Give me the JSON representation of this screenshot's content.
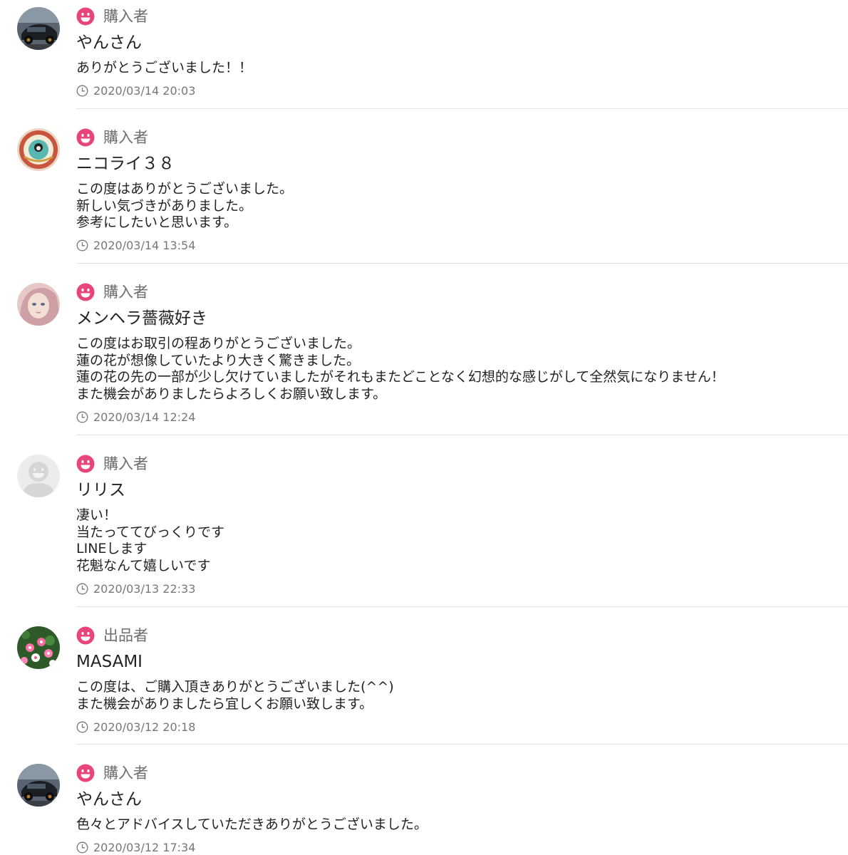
{
  "reviews": [
    {
      "role": "購入者",
      "username": "やんさん",
      "comment": [
        "ありがとうございました！！"
      ],
      "timestamp": "2020/03/14 20:03",
      "avatar": "car-photo"
    },
    {
      "role": "購入者",
      "username": "ニコライ３８",
      "comment": [
        "この度はありがとうございました。",
        "新しい気づきがありました。",
        "参考にしたいと思います。"
      ],
      "timestamp": "2020/03/14 13:54",
      "avatar": "bowl-photo"
    },
    {
      "role": "購入者",
      "username": "メンヘラ薔薇好き",
      "comment": [
        "この度はお取引の程ありがとうございました。",
        "蓮の花が想像していたより大きく驚きました。",
        "蓮の花の先の一部が少し欠けていましたがそれもまたどことなく幻想的な感じがして全然気になりません！",
        "また機会がありましたらよろしくお願い致します。"
      ],
      "timestamp": "2020/03/14 12:24",
      "avatar": "doll-photo"
    },
    {
      "role": "購入者",
      "username": "リリス",
      "comment": [
        "凄い！",
        "当たっててびっくりです",
        "LINEします",
        "花魁なんて嬉しいです"
      ],
      "timestamp": "2020/03/13 22:33",
      "avatar": "default-face"
    },
    {
      "role": "出品者",
      "username": "MASAMI",
      "comment": [
        "この度は、ご購入頂きありがとうございました(^^)",
        "また機会がありましたら宜しくお願い致します。"
      ],
      "timestamp": "2020/03/12 20:18",
      "avatar": "flower-photo"
    },
    {
      "role": "購入者",
      "username": "やんさん",
      "comment": [
        "色々とアドバイスしていただきありがとうございました。"
      ],
      "timestamp": "2020/03/12 17:34",
      "avatar": "car-photo"
    }
  ],
  "colors": {
    "accent_pink": "#e8457a",
    "role_text": "#6d6d6d",
    "meta_text": "#777777",
    "divider": "#e3e3e3"
  },
  "icons": {
    "role": "smile-face-icon",
    "time": "clock-icon"
  }
}
